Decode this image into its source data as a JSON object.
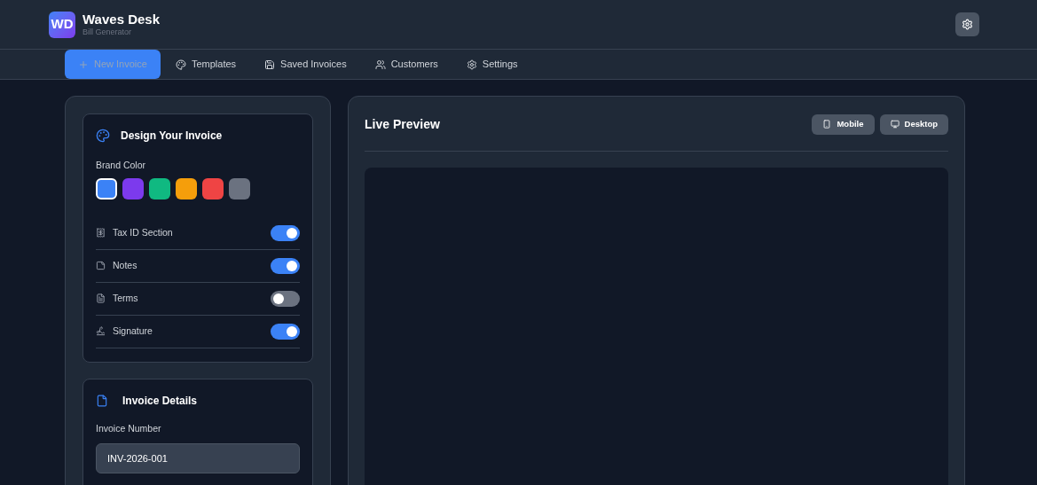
{
  "app": {
    "logo": "WD",
    "title": "Waves Desk",
    "subtitle": "Bill Generator"
  },
  "nav": [
    {
      "label": "New Invoice",
      "selected": true
    },
    {
      "label": "Templates",
      "selected": false
    },
    {
      "label": "Saved Invoices",
      "selected": false
    },
    {
      "label": "Customers",
      "selected": false
    },
    {
      "label": "Settings",
      "selected": false
    }
  ],
  "design": {
    "title": "Design Your Invoice",
    "brand_label": "Brand Color",
    "colors": [
      {
        "color": "#3b82f6",
        "selected": true
      },
      {
        "color": "#7c3aed",
        "selected": false
      },
      {
        "color": "#10b981",
        "selected": false
      },
      {
        "color": "#f59e0b",
        "selected": false
      },
      {
        "color": "#ef4444",
        "selected": false
      },
      {
        "color": "#6b7280",
        "selected": false
      }
    ],
    "toggles": [
      {
        "label": "Tax ID Section",
        "on": true
      },
      {
        "label": "Notes",
        "on": true
      },
      {
        "label": "Terms",
        "on": false
      },
      {
        "label": "Signature",
        "on": true
      }
    ]
  },
  "details": {
    "title": "Invoice Details",
    "field_label": "Invoice Number",
    "value": "INV-2026-001"
  },
  "preview": {
    "title": "Live Preview",
    "buttons": [
      {
        "label": "Mobile"
      },
      {
        "label": "Desktop"
      }
    ]
  }
}
